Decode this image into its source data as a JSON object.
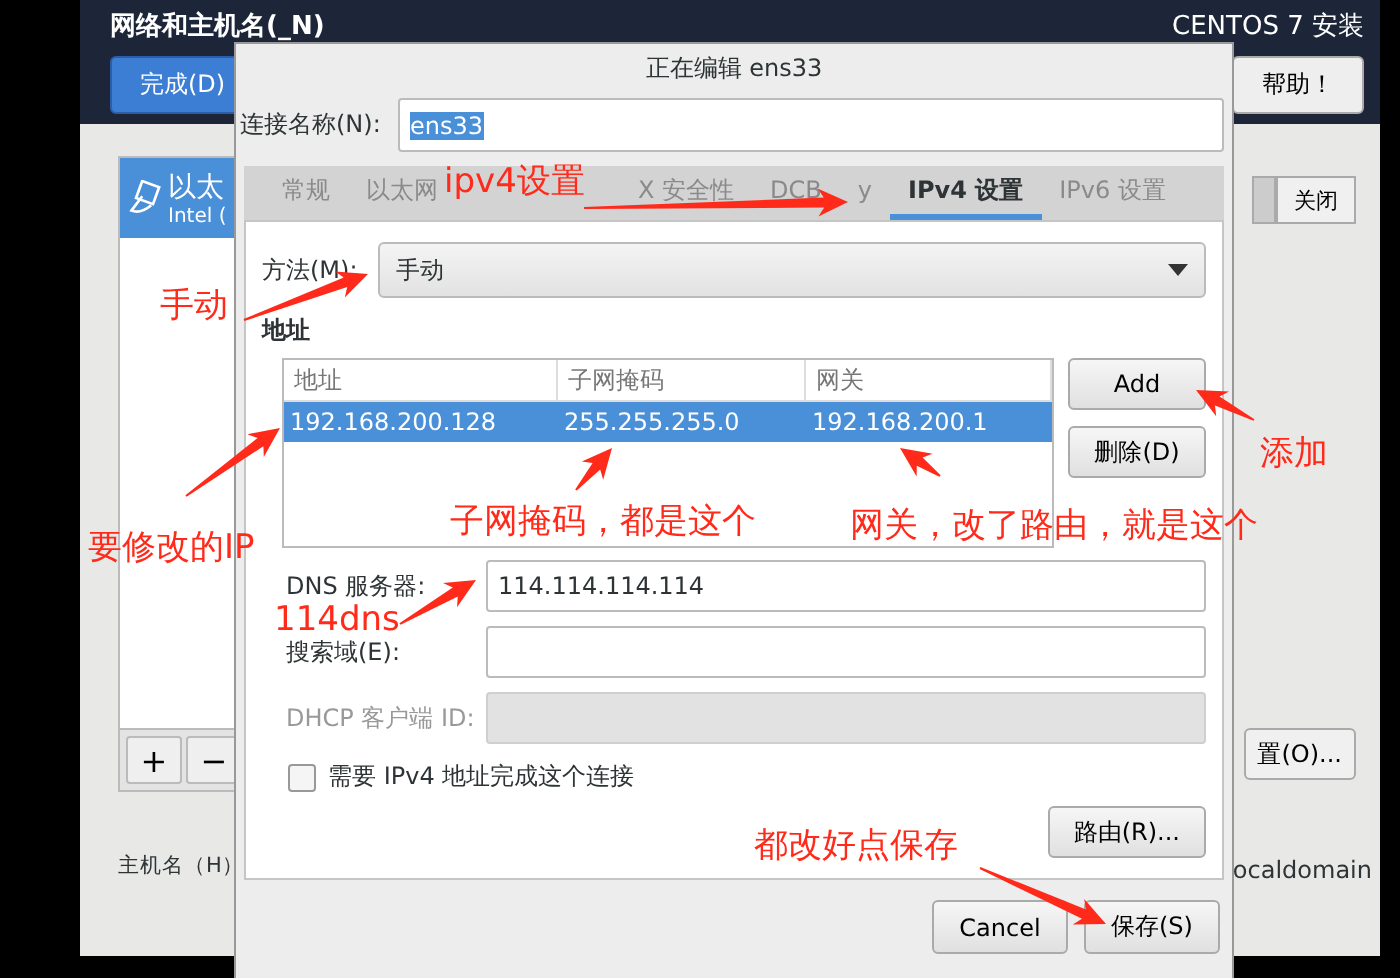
{
  "screen": {
    "title": "网络和主机名(_N)",
    "brand": "CENTOS 7 安装",
    "done_button": "完成(D)",
    "help_button": "帮助！",
    "device": {
      "name": "以太",
      "detail": "Intel (",
      "selected": true
    },
    "add_button": "+",
    "remove_button": "−",
    "off_button": "关闭",
    "configure_button": "置(O)...",
    "hostname_label": "主机名（H）",
    "domain": "ocaldomain"
  },
  "dialog": {
    "title": "正在编辑 ens33",
    "name_label": "连接名称(N):",
    "name_value": "ens33",
    "tabs": [
      {
        "label": "常规",
        "selected": false
      },
      {
        "label": "以太网",
        "selected": false
      },
      {
        "label": "X 安全性",
        "selected": false
      },
      {
        "label": "DCB",
        "selected": false
      },
      {
        "label": "y",
        "selected": false
      },
      {
        "label": "IPv4 设置",
        "selected": true
      },
      {
        "label": "IPv6 设置",
        "selected": false
      }
    ],
    "method_label": "方法(M):",
    "method_value": "手动",
    "address_heading": "地址",
    "address_table": {
      "columns": [
        "地址",
        "子网掩码",
        "网关"
      ],
      "rows": [
        {
          "cells": [
            "192.168.200.128",
            "255.255.255.0",
            "192.168.200.1"
          ],
          "selected": true
        }
      ]
    },
    "add_button": "Add",
    "delete_button": "删除(D)",
    "fields": [
      {
        "label": "DNS 服务器:",
        "value": "114.114.114.114",
        "disabled": false
      },
      {
        "label": "搜索域(E):",
        "disabled": false
      },
      {
        "label": "DHCP 客户端 ID:",
        "disabled": true
      }
    ],
    "require_ipv4": {
      "label": "需要 IPv4 地址完成这个连接",
      "checked": false
    },
    "routes_button": "路由(R)...",
    "cancel_button": "Cancel",
    "save_button": "保存(S)"
  },
  "annotations": [
    {
      "text": "ipv4设置"
    },
    {
      "text": "手动"
    },
    {
      "text": "添加"
    },
    {
      "text": "子网掩码，都是这个"
    },
    {
      "text": "网关，改了路由，就是这个"
    },
    {
      "text": "要修改的IP"
    },
    {
      "text": "114dns"
    },
    {
      "text": "都改好点保存"
    }
  ]
}
